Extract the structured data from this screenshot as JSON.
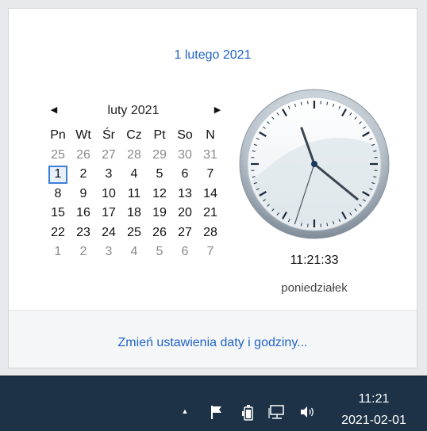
{
  "flyout": {
    "full_date": "1 lutego 2021",
    "settings_link": "Zmień ustawienia daty i godziny..."
  },
  "calendar": {
    "month_title": "luty 2021",
    "prev_icon": "triangle-left-icon",
    "next_icon": "triangle-right-icon",
    "weekdays": [
      "Pn",
      "Wt",
      "Śr",
      "Cz",
      "Pt",
      "So",
      "N"
    ],
    "weeks": [
      [
        "25",
        "26",
        "27",
        "28",
        "29",
        "30",
        "31"
      ],
      [
        "1",
        "2",
        "3",
        "4",
        "5",
        "6",
        "7"
      ],
      [
        "8",
        "9",
        "10",
        "11",
        "12",
        "13",
        "14"
      ],
      [
        "15",
        "16",
        "17",
        "18",
        "19",
        "20",
        "21"
      ],
      [
        "22",
        "23",
        "24",
        "25",
        "26",
        "27",
        "28"
      ],
      [
        "1",
        "2",
        "3",
        "4",
        "5",
        "6",
        "7"
      ]
    ],
    "selected_day": "1"
  },
  "clock": {
    "time": "11:21:33",
    "weekday": "poniedziałek",
    "hours": 11,
    "minutes": 21,
    "seconds": 33
  },
  "taskbar": {
    "time": "11:21",
    "date": "2021-02-01",
    "tray_icons": [
      "chevron-up-icon",
      "flag-icon",
      "battery-icon",
      "network-icon",
      "volume-icon"
    ]
  },
  "colors": {
    "accent": "#1f64c8",
    "taskbar": "#1d3247",
    "today_border": "#3d7fd6"
  }
}
